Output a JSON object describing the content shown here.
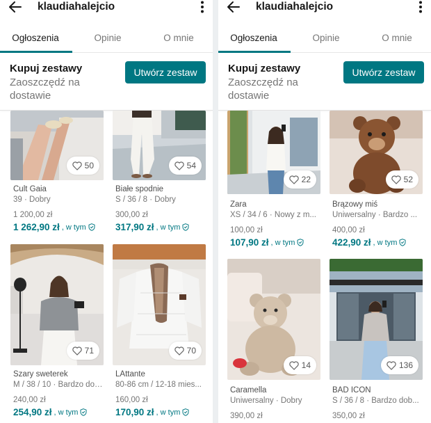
{
  "panels": [
    {
      "header": {
        "username": "klaudiahalejcio"
      },
      "tabs": [
        "Ogłoszenia",
        "Opinie",
        "O mnie"
      ],
      "bundle": {
        "title": "Kupuj zestawy",
        "subtitle": "Zaoszczędź na dostawie",
        "button": "Utwórz zestaw"
      },
      "items": [
        {
          "brand": "Cult Gaia",
          "details": "39 · Dobry",
          "price": "1 200,00 zł",
          "total": "1 262,90 zł",
          "incl": ", w tym",
          "favs": "50"
        },
        {
          "brand": "Białe spodnie",
          "details": "S / 36 / 8 · Dobry",
          "price": "300,00 zł",
          "total": "317,90 zł",
          "incl": ", w tym",
          "favs": "54"
        },
        {
          "brand": "Szary sweterek",
          "details": "M / 38 / 10 · Bardzo dob...",
          "price": "240,00 zł",
          "total": "254,90 zł",
          "incl": ", w tym",
          "favs": "71"
        },
        {
          "brand": "LAttante",
          "details": "80-86 cm / 12-18 mies...",
          "price": "160,00 zł",
          "total": "170,90 zł",
          "incl": ", w tym",
          "favs": "70"
        }
      ]
    },
    {
      "header": {
        "username": "klaudiahalejcio"
      },
      "tabs": [
        "Ogłoszenia",
        "Opinie",
        "O mnie"
      ],
      "bundle": {
        "title": "Kupuj zestawy",
        "subtitle": "Zaoszczędź na dostawie",
        "button": "Utwórz zestaw"
      },
      "items": [
        {
          "brand": "Zara",
          "details": "XS / 34 / 6 · Nowy z m...",
          "price": "100,00 zł",
          "total": "107,90 zł",
          "incl": ", w tym",
          "favs": "22"
        },
        {
          "brand": "Brązowy miś",
          "details": "Uniwersalny · Bardzo ...",
          "price": "400,00 zł",
          "total": "422,90 zł",
          "incl": ", w tym",
          "favs": "52"
        },
        {
          "brand": "Caramella",
          "details": "Uniwersalny · Dobry",
          "price": "390,00 zł",
          "total": "",
          "incl": "",
          "favs": "14"
        },
        {
          "brand": "BAD ICON",
          "details": "S / 36 / 8 · Bardzo dob...",
          "price": "350,00 zł",
          "total": "",
          "incl": "",
          "favs": "136"
        }
      ]
    }
  ],
  "icons": {
    "back": "arrow-left-icon",
    "menu": "kebab-menu-icon",
    "favorite": "heart-outline-icon",
    "protection": "shield-check-icon"
  },
  "colors": {
    "accent": "#007782",
    "text": "#171717",
    "muted": "#757575"
  }
}
